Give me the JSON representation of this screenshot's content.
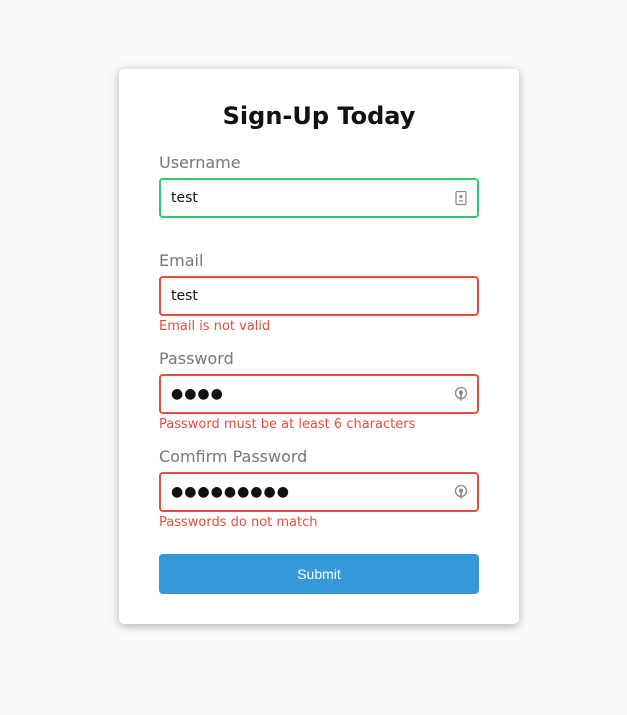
{
  "form": {
    "title": "Sign-Up Today",
    "submit_label": "Submit",
    "fields": [
      {
        "label": "Username",
        "value": "test",
        "state": "success",
        "icon": "contact-card-icon",
        "error": ""
      },
      {
        "label": "Email",
        "value": "test",
        "state": "error",
        "icon": "",
        "error": "Email is not valid"
      },
      {
        "label": "Password",
        "value": "●●●●",
        "state": "error",
        "icon": "password-key-icon",
        "error": "Password must be at least 6 characters"
      },
      {
        "label": "Comfirm Password",
        "value": "●●●●●●●●●",
        "state": "error",
        "icon": "password-key-icon",
        "error": "Passwords do not match"
      }
    ]
  },
  "colors": {
    "success": "#2ecc71",
    "error": "#e74c3c",
    "button": "#3498db",
    "label": "#777777"
  }
}
